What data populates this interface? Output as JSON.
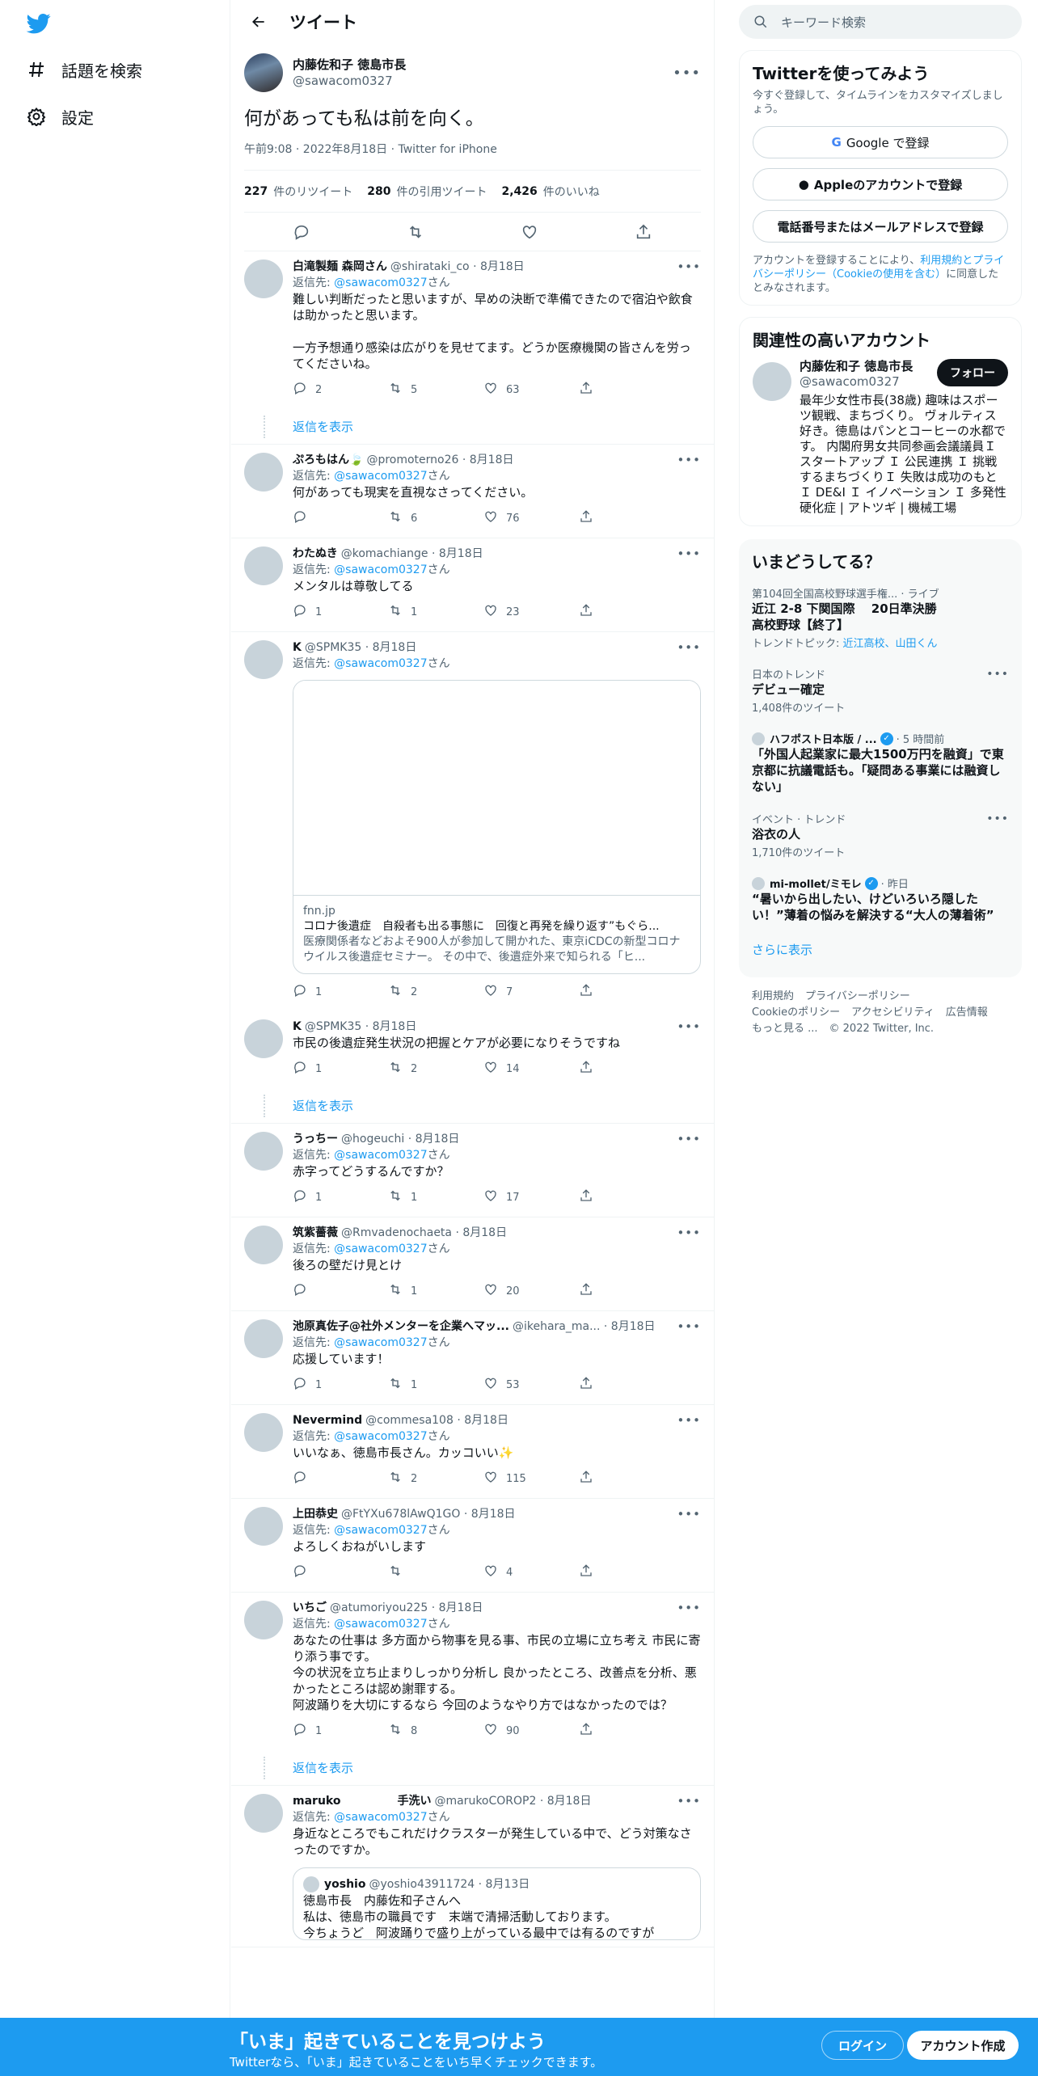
{
  "nav": {
    "explore": "話題を検索",
    "settings": "設定"
  },
  "header": {
    "title": "ツイート"
  },
  "main_tweet": {
    "name": "内藤佐和子 徳島市長",
    "handle": "@sawacom0327",
    "text": "何があっても私は前を向く。",
    "meta": "午前9:08 · 2022年8月18日 · Twitter for iPhone",
    "retweets": "227",
    "retweets_label": "件のリツイート",
    "quotes": "280",
    "quotes_label": "件の引用ツイート",
    "likes": "2,426",
    "likes_label": "件のいいね"
  },
  "reply_to_prefix": "返信先: ",
  "reply_to_handle": "@sawacom0327",
  "reply_to_suffix": "さん",
  "show_replies": "返信を表示",
  "replies": [
    {
      "name": "白滝製麺 森岡さん",
      "handle": "@shirataki_co",
      "date": "· 8月18日",
      "text": "難しい判断だったと思いますが、早めの決断で準備できたので宿泊や飲食は助かったと思います。\n\n一方予想通り感染は広がりを見せてます。どうか医療機関の皆さんを労ってくださいね。",
      "reply": "2",
      "retweet": "5",
      "like": "63"
    },
    {
      "name": "ぷろもはん🍃",
      "handle": "@promoterno26",
      "date": "· 8月18日",
      "text": "何があっても現実を直視なさってください。",
      "reply": "",
      "retweet": "6",
      "like": "76"
    },
    {
      "name": "わたぬき",
      "handle": "@komachiange",
      "date": "· 8月18日",
      "text": "メンタルは尊敬してる",
      "reply": "1",
      "retweet": "1",
      "like": "23"
    },
    {
      "name": "K",
      "handle": "@SPMK35",
      "date": "· 8月18日",
      "text": "",
      "reply": "1",
      "retweet": "2",
      "like": "7",
      "card": {
        "domain": "fnn.jp",
        "title": "コロナ後遺症　自殺者も出る事態に　回復と再発を繰り返す”もぐら...",
        "desc": "医療関係者などおよそ900人が参加して開かれた、東京iCDCの新型コロナウイルス後遺症セミナー。 その中で、後遺症外来で知られる「ヒ..."
      }
    },
    {
      "name": "K",
      "handle": "@SPMK35",
      "date": "· 8月18日",
      "text": "市民の後遺症発生状況の把握とケアが必要になりそうですね",
      "reply": "1",
      "retweet": "2",
      "like": "14"
    },
    {
      "name": "うっちー",
      "handle": "@hogeuchi",
      "date": "· 8月18日",
      "text": "赤字ってどうするんですか？",
      "reply": "1",
      "retweet": "1",
      "like": "17"
    },
    {
      "name": "筑紫薔薇",
      "handle": "@Rmvadenochaeta",
      "date": "· 8月18日",
      "text": "後ろの壁だけ見とけ",
      "reply": "",
      "retweet": "1",
      "like": "20"
    },
    {
      "name": "池原真佐子@社外メンターを企業へマッ...",
      "handle": "@ikehara_ma...",
      "date": "· 8月18日",
      "text": "応援しています！",
      "reply": "1",
      "retweet": "1",
      "like": "53"
    },
    {
      "name": "Nevermind",
      "handle": "@commesa108",
      "date": "· 8月18日",
      "text": "いいなぁ、徳島市長さん。カッコいい✨",
      "reply": "",
      "retweet": "2",
      "like": "115"
    },
    {
      "name": "上田恭史",
      "handle": "@FtYXu678lAwQ1GO",
      "date": "· 8月18日",
      "text": "よろしくおねがいします",
      "reply": "",
      "retweet": "",
      "like": "4"
    },
    {
      "name": "いちご",
      "handle": "@atumoriyou225",
      "date": "· 8月18日",
      "text": "あなたの仕事は 多方面から物事を見る事、市民の立場に立ち考え 市民に寄り添う事です。\n今の状況を立ち止まりしっかり分析し 良かったところ、改善点を分析、悪かったところは認め謝罪する。\n阿波踊りを大切にするなら 今回のようなやり方ではなかったのでは？",
      "reply": "1",
      "retweet": "8",
      "like": "90"
    },
    {
      "name": "maruko　　　　　手洗い",
      "handle": "@marukoCOROP2",
      "date": "· 8月18日",
      "text": "身近なところでもこれだけクラスターが発生している中で、どう対策なさったのですか。",
      "reply": "",
      "retweet": "",
      "like": "",
      "quote": {
        "name": "yoshio",
        "handle": "@yoshio43911724",
        "date": "· 8月13日",
        "text": "徳島市長　内藤佐和子さんへ\n私は、徳島市の職員です　末端で清掃活動しております。\n今ちょうど　阿波踊りで盛り上がっている最中では有るのですが\n自分の職場　今週中からずっとコロナが蔓延し\n職員六十人の中二十人余りが感染しております"
      }
    }
  ],
  "search": {
    "placeholder": "キーワード検索"
  },
  "signup_box": {
    "title": "Twitterを使ってみよう",
    "sub": "今すぐ登録して、タイムラインをカスタマイズしましょう。",
    "google": "Google で登録",
    "apple": "Appleのアカウントで登録",
    "phone": "電話番号またはメールアドレスで登録",
    "legal_1": "アカウントを登録することにより、",
    "legal_link": "利用規約とプライバシーポリシー（Cookieの使用を含む）",
    "legal_2": "に同意したとみなされます。"
  },
  "related": {
    "title": "関連性の高いアカウント",
    "name": "内藤佐和子 徳島市長",
    "handle": "@sawacom0327",
    "follow": "フォロー",
    "bio": "最年少女性市長(38歳) 趣味はスポーツ観戦、まちづくり。 ヴォルティス好き。徳島はパンとコーヒーの水都です。 内閣府男女共同参画会議議員Ｉスタートアップ Ｉ 公民連携 Ｉ 挑戦するまちづくりＩ 失敗は成功のもとＩ DE&I Ｉ イノベーション Ｉ 多発性硬化症 | アトツギ | 機械工場"
  },
  "trends": {
    "title": "いまどうしてる？",
    "items": [
      {
        "category": "第104回全国高校野球選手権... · ライブ",
        "text": "近江 2-8 下関国際　 20日準決勝\n高校野球【終了】",
        "note_prefix": "トレンドトピック: ",
        "note_link": "近江高校、山田くん"
      },
      {
        "category": "日本のトレンド",
        "text": "デビュー確定",
        "note": "1,408件のツイート"
      },
      {
        "source": "ハフポスト日本版 / ...",
        "time": "· 5 時間前",
        "text": "「外国人起業家に最大1500万円を融資」で東京都に抗議電話も。「疑問ある事業には融資しない」"
      },
      {
        "category": "イベント · トレンド",
        "text": "浴衣の人",
        "note": "1,710件のツイート"
      },
      {
        "source": "mi-mollet/ミモレ",
        "time": "· 昨日",
        "text": "“暑いから出したい、けどいろいろ隠したい！”薄着の悩みを解決する“大人の薄着術”"
      }
    ],
    "show_more": "さらに表示"
  },
  "footer": {
    "terms": "利用規約",
    "privacy": "プライバシーポリシー",
    "cookie": "Cookieのポリシー",
    "access": "アクセシビリティ",
    "ads": "広告情報",
    "more": "もっと見る ...",
    "copyright": "© 2022 Twitter, Inc."
  },
  "bottom_bar": {
    "title": "「いま」起きていることを見つけよう",
    "sub": "Twitterなら、「いま」起きていることをいち早くチェックできます。",
    "login": "ログイン",
    "signup": "アカウント作成"
  }
}
